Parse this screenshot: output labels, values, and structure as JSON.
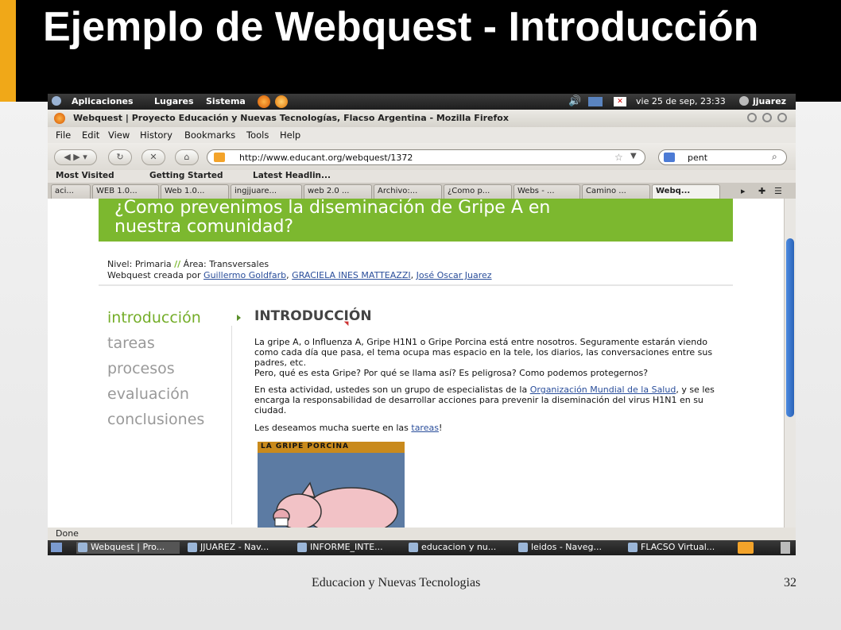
{
  "slide": {
    "title": "Ejemplo de Webquest - Introducción",
    "footer": "Educacion y Nuevas Tecnologias",
    "page_number": "32"
  },
  "gnome_panel": {
    "menus": [
      "Aplicaciones",
      "Lugares",
      "Sistema"
    ],
    "datetime": "vie 25 de sep, 23:33",
    "user": "jjuarez"
  },
  "window": {
    "title": "Webquest | Proyecto Educación y Nuevas Tecnologías, Flacso Argentina - Mozilla Firefox"
  },
  "menubar": [
    "File",
    "Edit",
    "View",
    "History",
    "Bookmarks",
    "Tools",
    "Help"
  ],
  "navbar": {
    "url": "http://www.educant.org/webquest/1372",
    "search_value": "pent"
  },
  "bookmarks": [
    "Most Visited",
    "Getting Started",
    "Latest Headlin..."
  ],
  "tabs": [
    "aci...",
    "WEB 1.0...",
    "Web 1.0...",
    "ingjjuare...",
    "web 2.0 ...",
    "Archivo:...",
    "¿Como p...",
    "Webs - ...",
    "Camino ...",
    "Webq..."
  ],
  "page": {
    "banner_line1": "¿Como prevenimos la diseminación de Gripe A en",
    "banner_line2": "nuestra comunidad?",
    "nivel_label": "Nivel: Primaria",
    "area_sep": "//",
    "area_label": "Área: Transversales",
    "created_by": "Webquest creada por",
    "author1": "Guillermo Goldfarb",
    "author2": "GRACIELA INES MATTEAZZI",
    "author3": "José Oscar Juarez",
    "nav": [
      "introducción",
      "tareas",
      "procesos",
      "evaluación",
      "conclusiones"
    ],
    "heading": "INTRODUCCIÓN",
    "p1": "La gripe A, o Influenza A, Gripe H1N1 o Gripe Porcina está entre nosotros. Seguramente estarán viendo como cada día que pasa, el tema ocupa mas espacio en la tele, los diarios, las conversaciones entre sus padres, etc.",
    "p1b": "Pero, qué es esta Gripe? Por qué se llama así? Es peligrosa? Como podemos protegernos?",
    "p2_start": "En esta actividad, ustedes son un grupo de especialistas de la",
    "p2_link": "Organización Mundial de la Salud",
    "p2_end": ", y se les encarga la responsabilidad de desarrollar acciones para prevenir la diseminación del virus H1N1 en su ciudad.",
    "p3_start": "Les deseamos mucha suerte en las",
    "p3_link": "tareas",
    "p3_end": "!",
    "image_caption": "LA GRIPE PORCINA"
  },
  "statusbar": {
    "text": "Done"
  },
  "taskbar": [
    "Webquest | Pro...",
    "JJUAREZ - Nav...",
    "INFORME_INTE...",
    "educacion y nu...",
    "leidos - Naveg...",
    "FLACSO Virtual..."
  ]
}
